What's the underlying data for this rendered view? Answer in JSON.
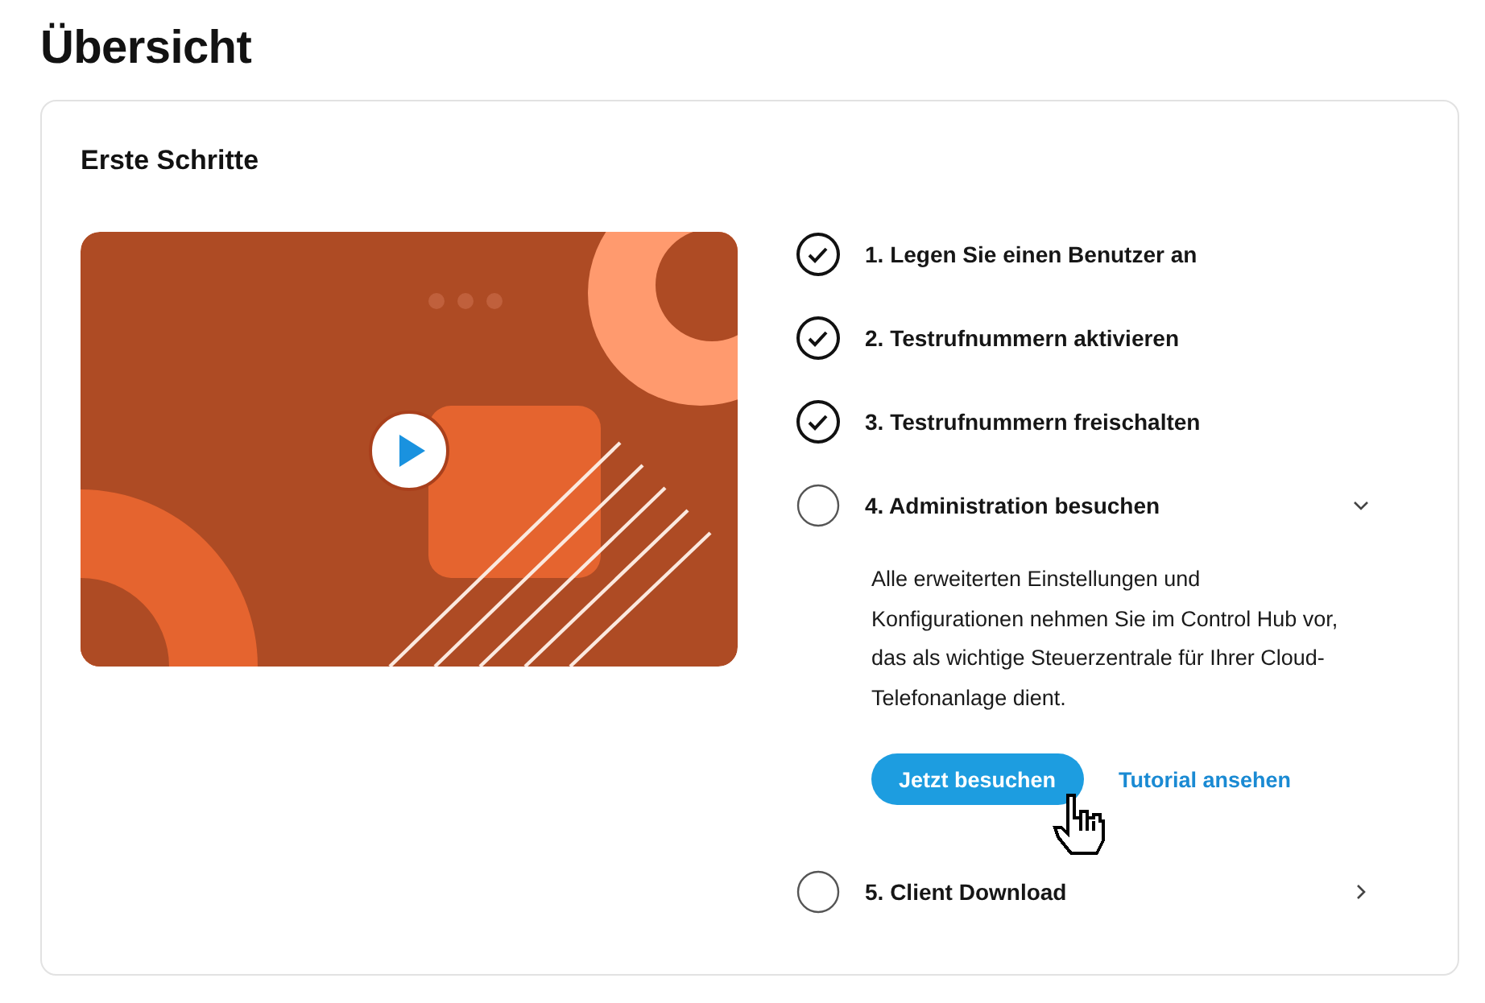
{
  "page_title": "Übersicht",
  "card": {
    "heading": "Erste Schritte",
    "steps": [
      {
        "label": "1. Legen Sie einen Benutzer an",
        "done": true
      },
      {
        "label": "2. Testrufnummern aktivieren",
        "done": true
      },
      {
        "label": "3. Testrufnummern freischalten",
        "done": true
      },
      {
        "label": "4. Administration besuchen",
        "done": false,
        "expanded": true,
        "description": "Alle erweiterten Einstellungen und Konfigurationen nehmen Sie im Control Hub vor, das als wichtige Steuerzentrale für Ihrer Cloud-Telefonanlage dient.",
        "primary_button": "Jetzt besuchen",
        "link": "Tutorial ansehen"
      },
      {
        "label": "5. Client Download",
        "done": false,
        "expanded": false
      }
    ]
  }
}
